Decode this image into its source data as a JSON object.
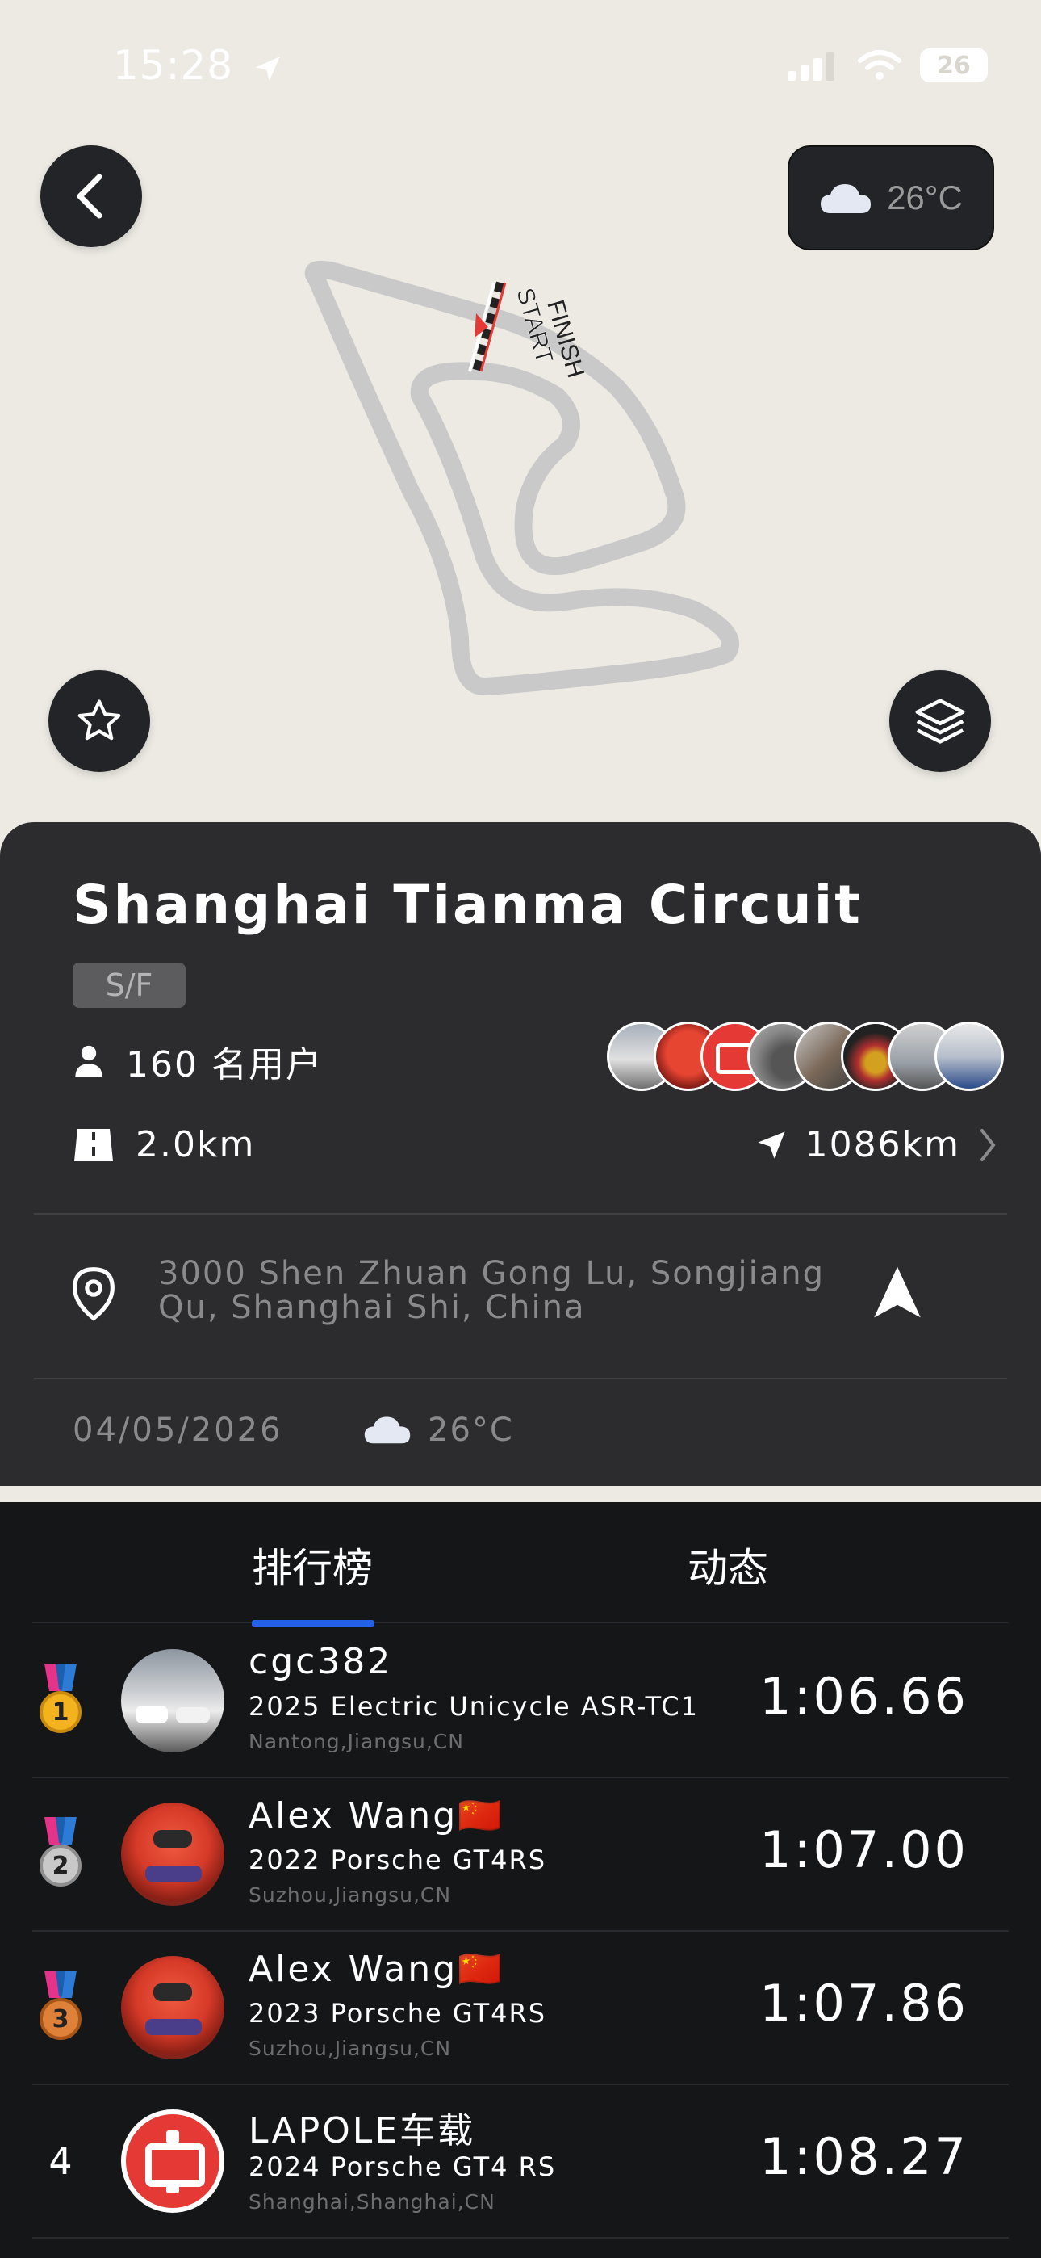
{
  "status_bar": {
    "time": "15:28",
    "battery": "26"
  },
  "weather": {
    "temperature": "26°C"
  },
  "map": {
    "start_label": "START",
    "finish_label": "FINISH"
  },
  "track": {
    "name": "Shanghai Tianma Circuit",
    "badge": "S/F",
    "users": "160 名用户",
    "length": "2.0km",
    "distance": "1086km",
    "address": "3000 Shen Zhuan Gong Lu, Songjiang Qu, Shanghai Shi, China",
    "date": "04/05/2026",
    "temperature": "26°C"
  },
  "tabs": [
    {
      "label": "排行榜",
      "active": true
    },
    {
      "label": "动态",
      "active": false
    }
  ],
  "leaderboard": [
    {
      "rank": "1",
      "name": "cgc382",
      "car": "2025 Electric Unicycle ASR-TC1",
      "location": "Nantong,Jiangsu,CN",
      "time": "1:06.66",
      "medal": "1"
    },
    {
      "rank": "2",
      "name": "Alex  Wang🇨🇳",
      "car": "2022 Porsche GT4RS",
      "location": "Suzhou,Jiangsu,CN",
      "time": "1:07.00",
      "medal": "2"
    },
    {
      "rank": "3",
      "name": "Alex  Wang🇨🇳",
      "car": "2023 Porsche GT4RS",
      "location": "Suzhou,Jiangsu,CN",
      "time": "1:07.86",
      "medal": "3"
    },
    {
      "rank": "4",
      "name": "LAPOLE车载",
      "car": "2024 Porsche GT4 RS",
      "location": "Shanghai,Shanghai,CN",
      "time": "1:08.27",
      "medal": ""
    }
  ],
  "colors": {
    "accent": "#2460E8",
    "card": "#2C2C2E",
    "board": "#151618",
    "map_bg": "#ECEAE3",
    "track": "#C9C9C9"
  }
}
